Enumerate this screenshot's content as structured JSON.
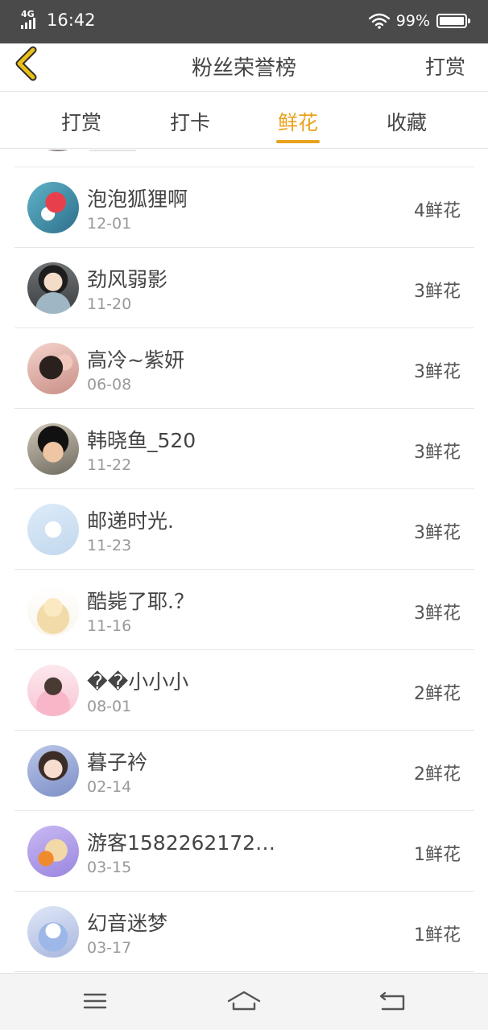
{
  "status_bar": {
    "network": "4G",
    "time": "16:42",
    "battery_percent": "99%",
    "battery_level": 0.99,
    "icons": [
      "signal-icon",
      "wifi-icon",
      "battery-icon"
    ]
  },
  "header": {
    "back_icon": "chevron-left-icon",
    "title": "粉丝荣誉榜",
    "action_label": "打赏"
  },
  "tabs": [
    {
      "label": "打赏",
      "active": false
    },
    {
      "label": "打卡",
      "active": false
    },
    {
      "label": "鲜花",
      "active": true
    },
    {
      "label": "收藏",
      "active": false
    }
  ],
  "colors": {
    "accent": "#e8a21c",
    "status_bar_bg": "#4a4a4a",
    "divider": "#e6e6e6"
  },
  "list": {
    "items": [
      {
        "name": "泡泡狐狸啊",
        "date": "12-01",
        "count": "4鲜花"
      },
      {
        "name": "劲风弱影",
        "date": "11-20",
        "count": "3鲜花"
      },
      {
        "name": "高冷~紫妍",
        "date": "06-08",
        "count": "3鲜花"
      },
      {
        "name": "韩晓鱼_520",
        "date": "11-22",
        "count": "3鲜花"
      },
      {
        "name": "邮递时光.",
        "date": "11-23",
        "count": "3鲜花"
      },
      {
        "name": "酷毙了耶.？",
        "date": "11-16",
        "count": "3鲜花"
      },
      {
        "name": "��小小小",
        "date": "08-01",
        "count": "2鲜花"
      },
      {
        "name": "暮子衿",
        "date": "02-14",
        "count": "2鲜花"
      },
      {
        "name": "游客1582262172…",
        "date": "03-15",
        "count": "1鲜花"
      },
      {
        "name": "幻音迷梦",
        "date": "03-17",
        "count": "1鲜花"
      }
    ]
  },
  "nav_bar": {
    "icons": [
      "menu-icon",
      "home-icon",
      "back-arrow-icon"
    ]
  }
}
